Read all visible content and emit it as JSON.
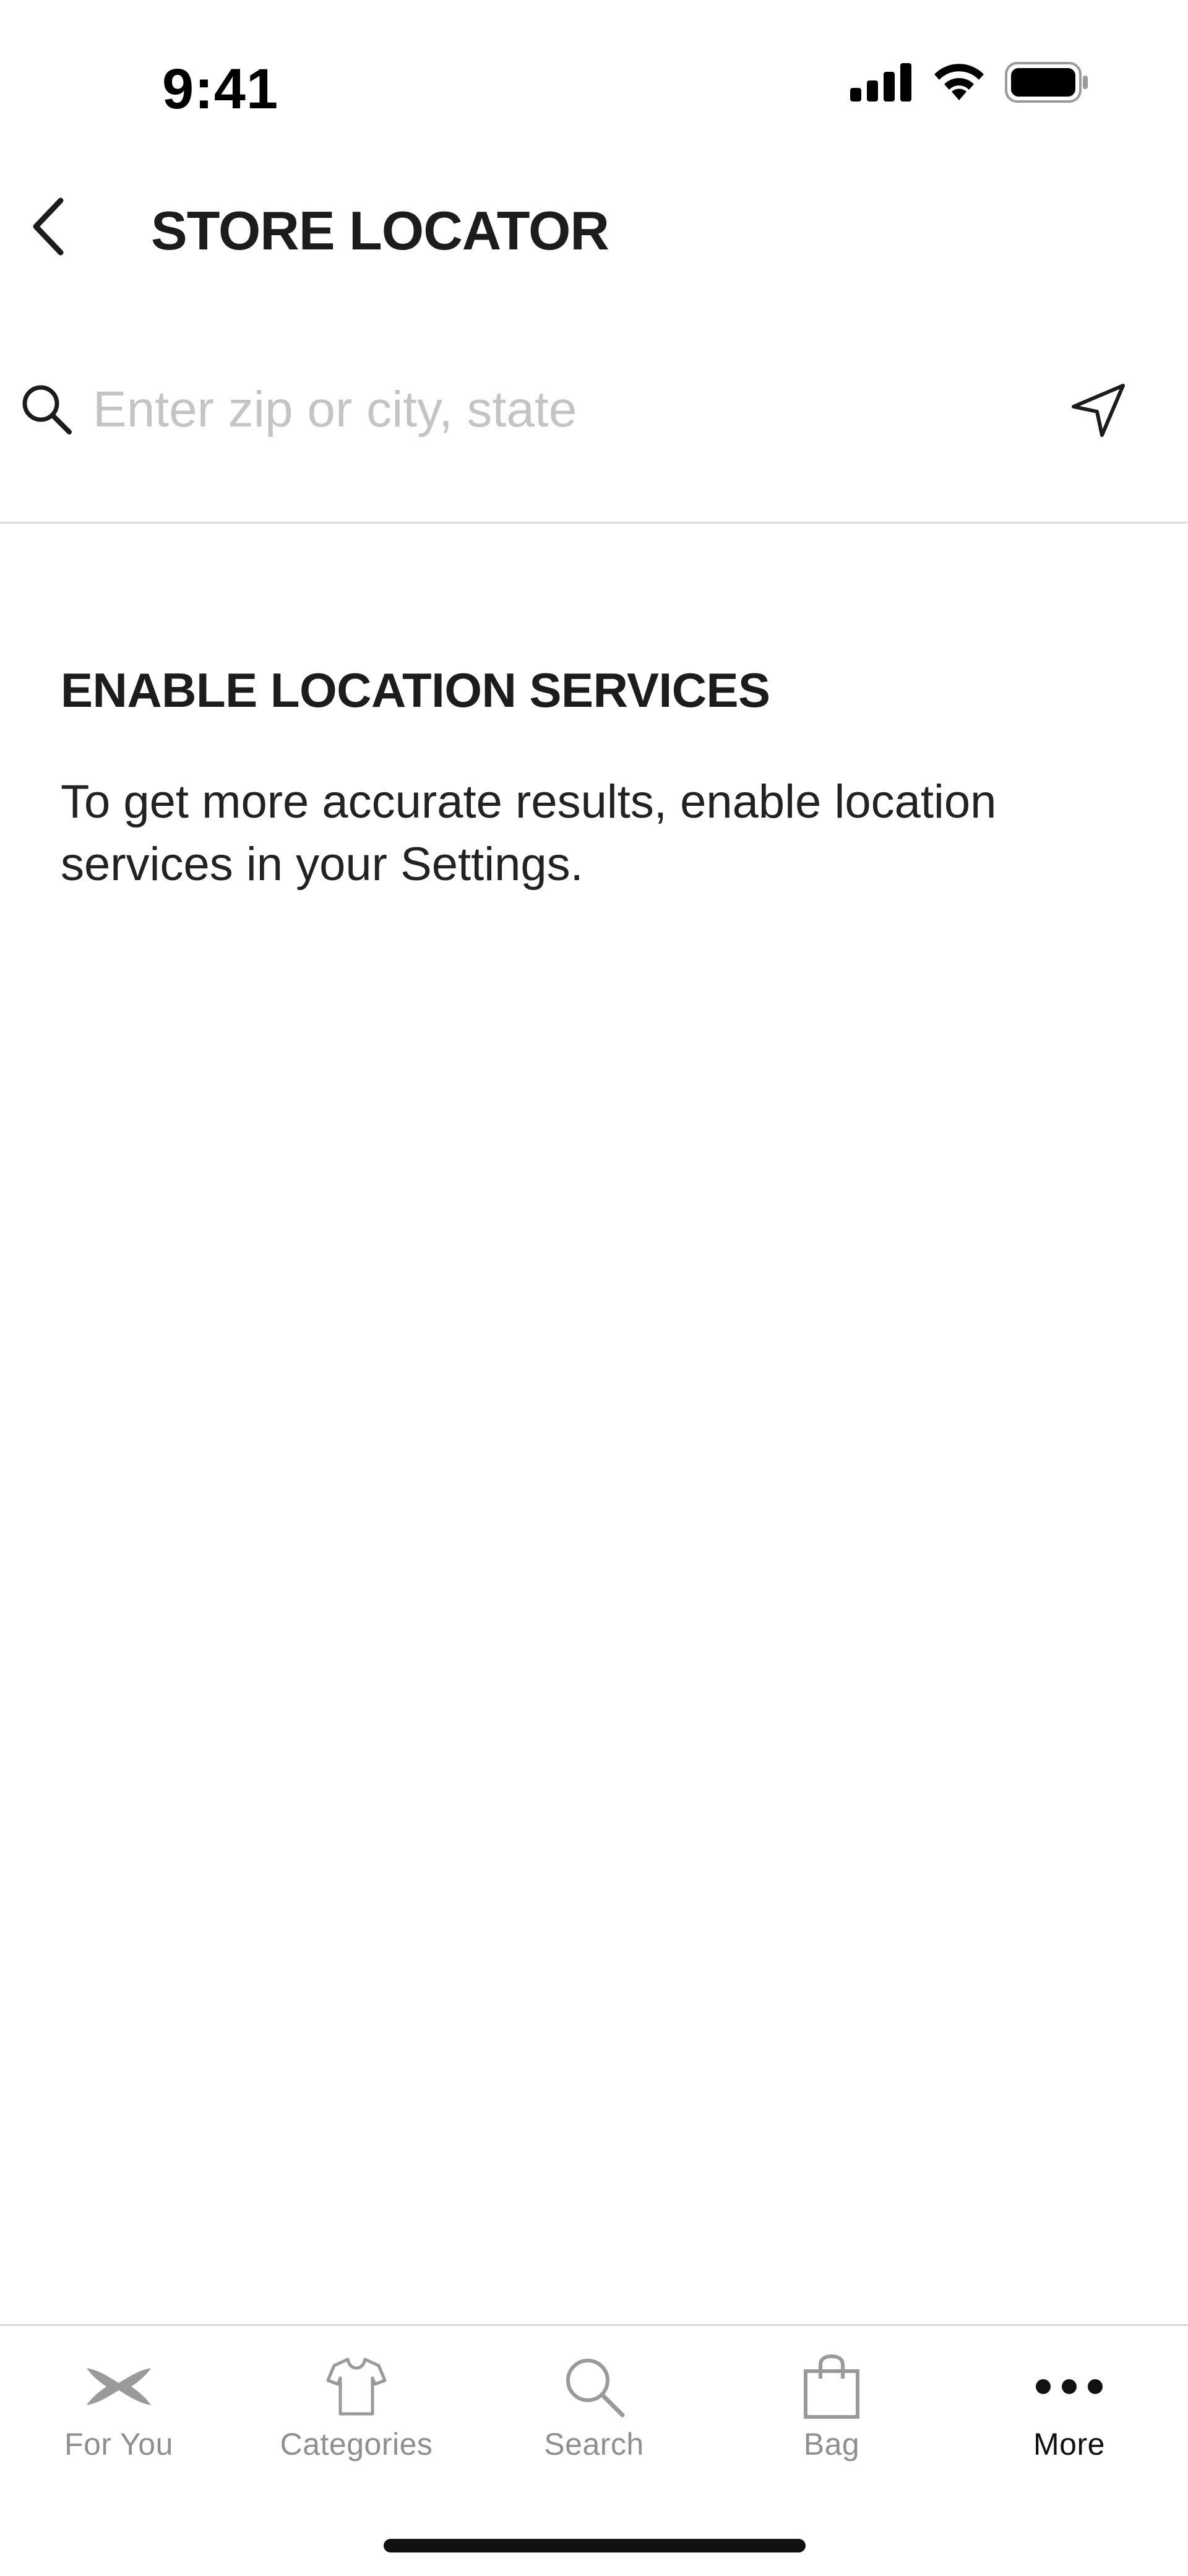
{
  "status_bar": {
    "time": "9:41",
    "icons": [
      "cellular-signal-icon",
      "wifi-icon",
      "battery-icon"
    ]
  },
  "header": {
    "title": "STORE LOCATOR",
    "back_icon": "chevron-left-icon"
  },
  "search": {
    "value": "",
    "placeholder": "Enter zip or city, state",
    "search_icon": "search-icon",
    "locate_icon": "location-arrow-icon"
  },
  "info": {
    "heading": "ENABLE LOCATION SERVICES",
    "body": "To get more accurate results, enable location services in your Settings."
  },
  "tab_bar": {
    "tabs": [
      {
        "label": "For You",
        "icon": "brand-logo-icon",
        "active": false
      },
      {
        "label": "Categories",
        "icon": "shirt-icon",
        "active": false
      },
      {
        "label": "Search",
        "icon": "search-icon",
        "active": false
      },
      {
        "label": "Bag",
        "icon": "shopping-bag-icon",
        "active": false
      },
      {
        "label": "More",
        "icon": "more-dots-icon",
        "active": true
      }
    ]
  },
  "colors": {
    "text_primary": "#1c1c1c",
    "placeholder": "#c4c4c4",
    "tab_inactive": "#8f8f8f",
    "tab_active": "#111111",
    "divider": "#dedede"
  }
}
